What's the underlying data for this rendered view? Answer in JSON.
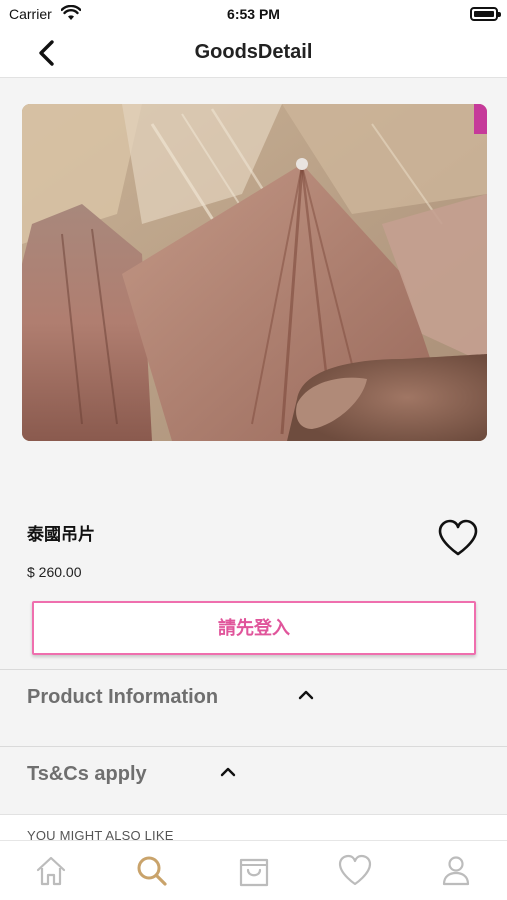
{
  "status_bar": {
    "carrier": "Carrier",
    "time": "6:53 PM"
  },
  "nav": {
    "title": "GoodsDetail"
  },
  "product": {
    "name": "泰國吊片",
    "price": "$ 260.00",
    "favorited": false
  },
  "login_button": {
    "label": "請先登入"
  },
  "sections": [
    {
      "title": "Product Information",
      "expanded": false
    },
    {
      "title": "Ts&Cs apply",
      "expanded": false
    }
  ],
  "recommendations": {
    "header": "YOU MIGHT ALSO LIKE"
  },
  "tab_bar": {
    "tabs": [
      {
        "icon": "home-icon",
        "active": false
      },
      {
        "icon": "search-icon",
        "active": true
      },
      {
        "icon": "cart-icon",
        "active": false
      },
      {
        "icon": "heart-icon",
        "active": false
      },
      {
        "icon": "user-icon",
        "active": false
      }
    ]
  },
  "colors": {
    "accent_pink": "#e0559b",
    "active_tab": "#c9a36b",
    "inactive_tab": "#bcbcbc"
  }
}
